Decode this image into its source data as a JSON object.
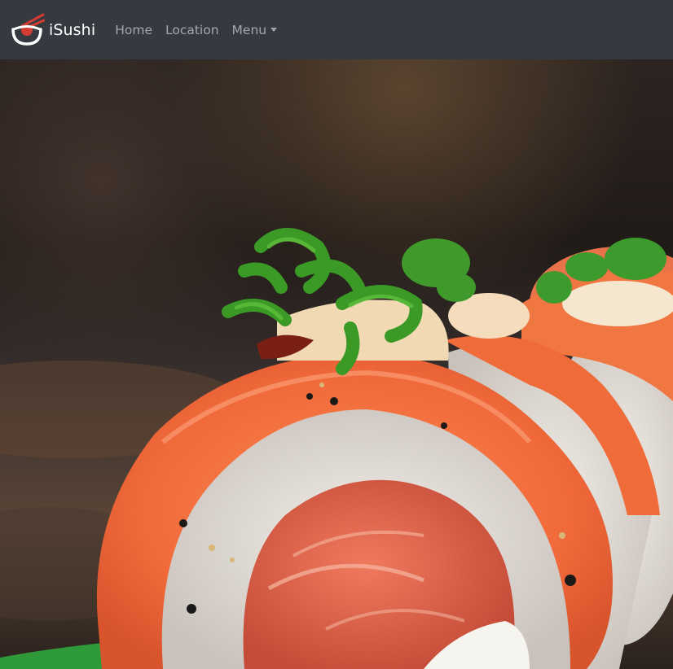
{
  "navbar": {
    "brand": {
      "name": "iSushi",
      "logo_icon": "sushi-bowl-chopsticks-icon"
    },
    "links": [
      {
        "label": "Home"
      },
      {
        "label": "Location"
      },
      {
        "label": "Menu",
        "has_dropdown": true
      }
    ],
    "background_color": "#343a40"
  },
  "hero": {
    "image": "salmon-sushi-roll-photo",
    "accent_colors": [
      "#f0733f",
      "#e9ecef",
      "#3f8f2a"
    ]
  }
}
